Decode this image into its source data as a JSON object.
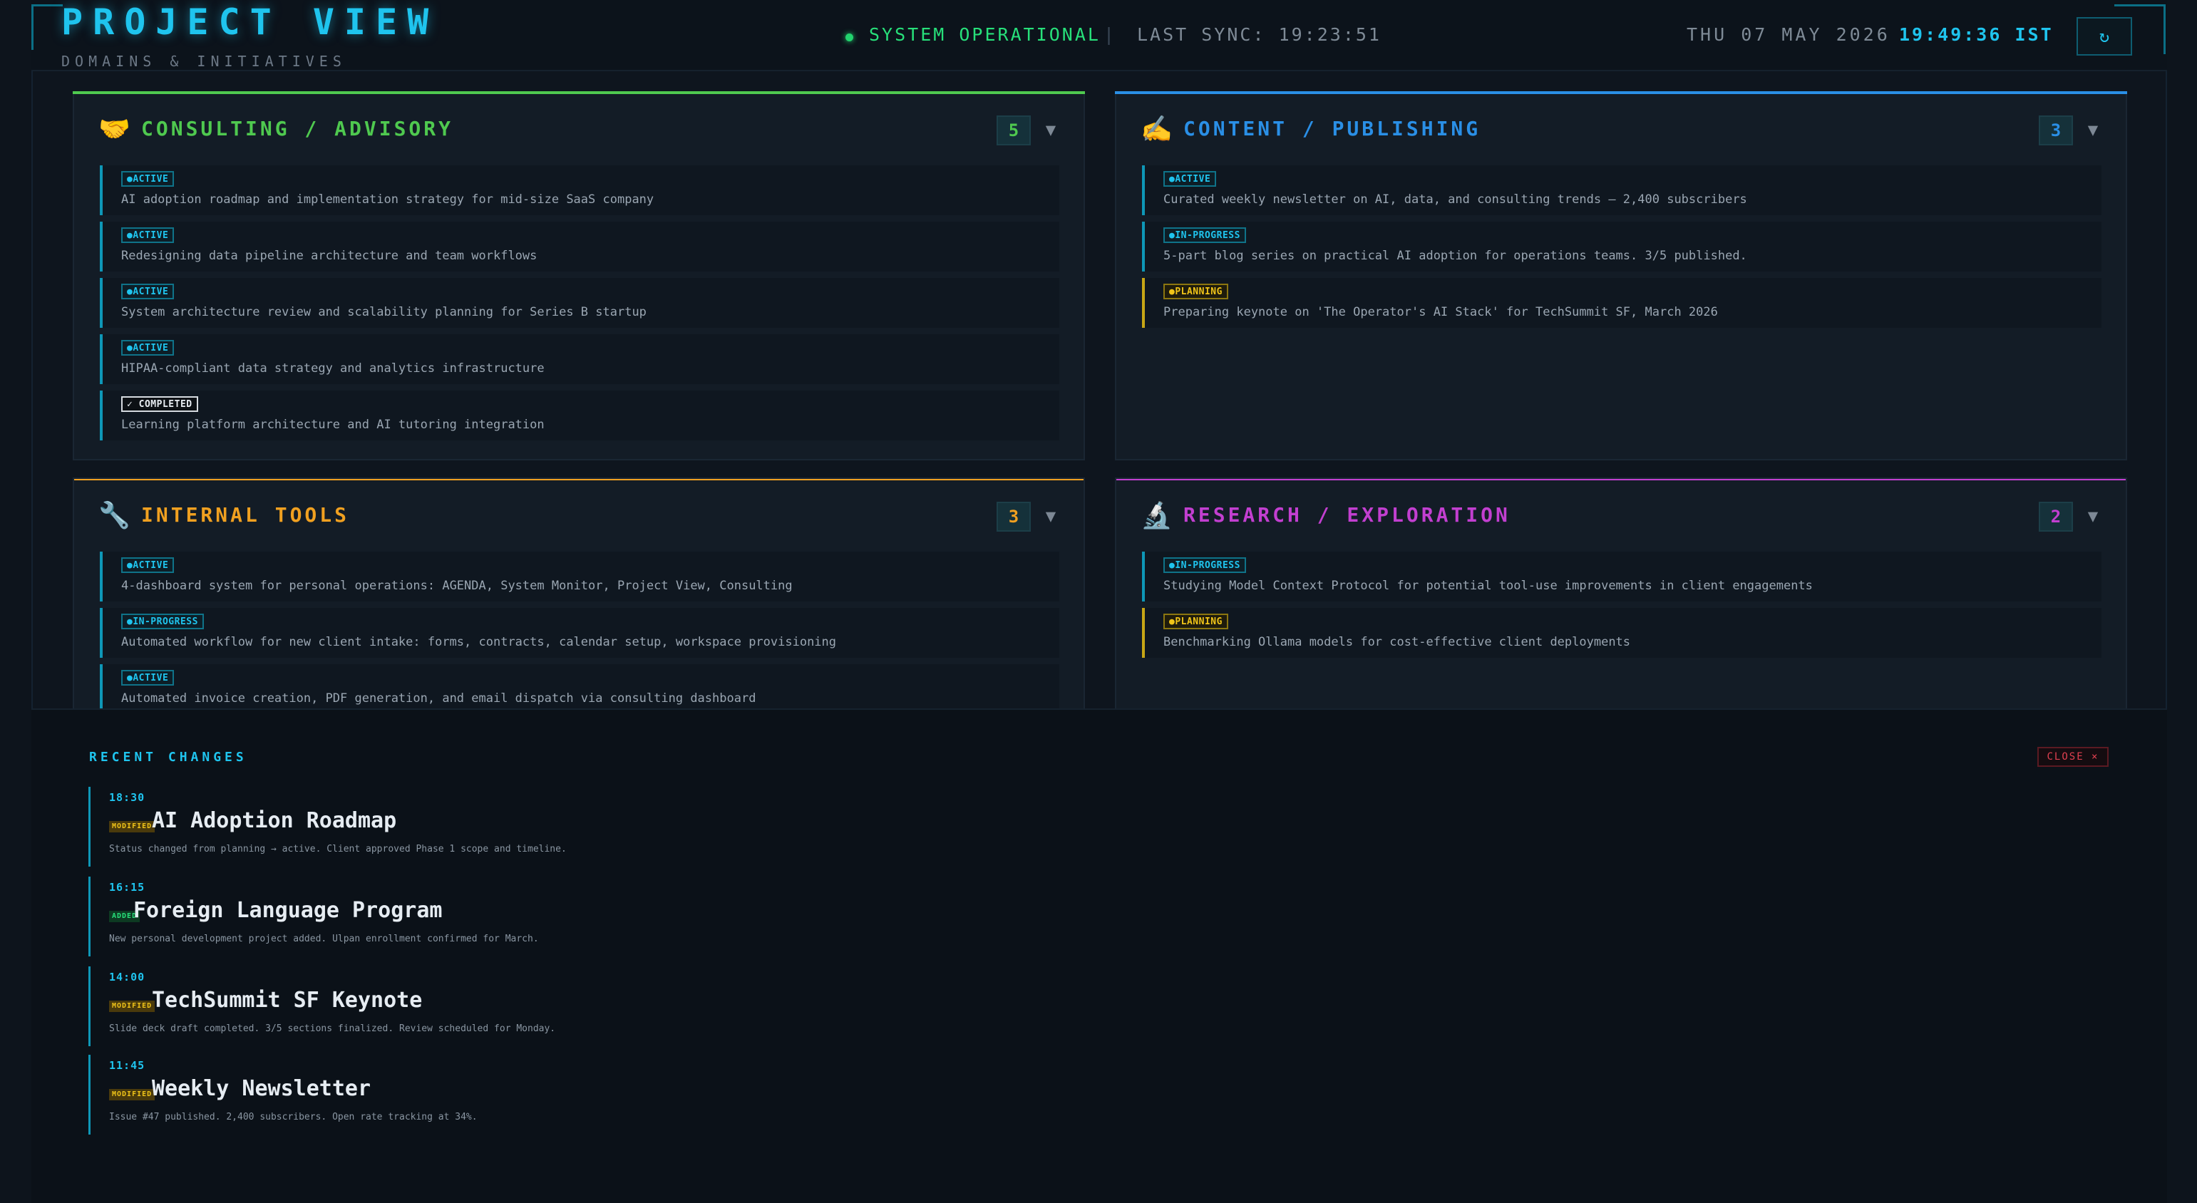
{
  "header": {
    "title": "PROJECT VIEW",
    "subtitle": "DOMAINS & INITIATIVES",
    "status": "SYSTEM OPERATIONAL",
    "separator": "|",
    "last_sync": "LAST SYNC: 19:23:51",
    "date": "THU 07 MAY 2026",
    "time": "19:49:36 IST",
    "refresh_icon": "↻"
  },
  "colors": {
    "accent": "#1fc4ee",
    "consulting": "#4fc94f",
    "content": "#2a8fe6",
    "internal": "#f0a020",
    "research": "#c23fd0",
    "planning": "#f0c419",
    "operational": "#27e07a"
  },
  "panels": [
    {
      "icon": "🤝",
      "icon_name": "handshake-icon",
      "title": "CONSULTING / ADVISORY",
      "count": "5",
      "chevron": "▼",
      "items": [
        {
          "status": "●ACTIVE",
          "kind": "active",
          "text": "AI adoption roadmap and implementation strategy for mid-size SaaS company"
        },
        {
          "status": "●ACTIVE",
          "kind": "active",
          "text": "Redesigning data pipeline architecture and team workflows"
        },
        {
          "status": "●ACTIVE",
          "kind": "active",
          "text": "System architecture review and scalability planning for Series B startup"
        },
        {
          "status": "●ACTIVE",
          "kind": "active",
          "text": "HIPAA-compliant data strategy and analytics infrastructure"
        },
        {
          "status": "✓ COMPLETED",
          "kind": "completed",
          "text": "Learning platform architecture and AI tutoring integration"
        }
      ]
    },
    {
      "icon": "✍️",
      "icon_name": "writing-hand-icon",
      "title": "CONTENT / PUBLISHING",
      "count": "3",
      "chevron": "▼",
      "items": [
        {
          "status": "●ACTIVE",
          "kind": "active",
          "text": "Curated weekly newsletter on AI, data, and consulting trends — 2,400 subscribers"
        },
        {
          "status": "●IN-PROGRESS",
          "kind": "active",
          "text": "5-part blog series on practical AI adoption for operations teams. 3/5 published."
        },
        {
          "status": "●PLANNING",
          "kind": "planning",
          "text": "Preparing keynote on 'The Operator's AI Stack' for TechSummit SF, March 2026"
        }
      ]
    },
    {
      "icon": "🔧",
      "icon_name": "wrench-icon",
      "title": "INTERNAL TOOLS",
      "count": "3",
      "chevron": "▼",
      "items": [
        {
          "status": "●ACTIVE",
          "kind": "active",
          "text": "4-dashboard system for personal operations: AGENDA, System Monitor, Project View, Consulting"
        },
        {
          "status": "●IN-PROGRESS",
          "kind": "active",
          "text": "Automated workflow for new client intake: forms, contracts, calendar setup, workspace provisioning"
        },
        {
          "status": "●ACTIVE",
          "kind": "active",
          "text": "Automated invoice creation, PDF generation, and email dispatch via consulting dashboard"
        }
      ]
    },
    {
      "icon": "🔬",
      "icon_name": "microscope-icon",
      "title": "RESEARCH / EXPLORATION",
      "count": "2",
      "chevron": "▼",
      "items": [
        {
          "status": "●IN-PROGRESS",
          "kind": "active",
          "text": "Studying Model Context Protocol for potential tool-use improvements in client engagements"
        },
        {
          "status": "●PLANNING",
          "kind": "planning",
          "text": "Benchmarking Ollama models for cost-effective client deployments"
        }
      ]
    }
  ],
  "recent": {
    "title": "RECENT CHANGES",
    "close_label": "CLOSE ×",
    "changes": [
      {
        "time": "18:30",
        "tag": "MODIFIED",
        "kind": "modified",
        "name": "AI Adoption Roadmap",
        "desc": "Status changed from planning → active. Client approved Phase 1 scope and timeline."
      },
      {
        "time": "16:15",
        "tag": "ADDED",
        "kind": "added",
        "name": "Foreign Language Program",
        "desc": "New personal development project added. Ulpan enrollment confirmed for March."
      },
      {
        "time": "14:00",
        "tag": "MODIFIED",
        "kind": "modified",
        "name": "TechSummit SF Keynote",
        "desc": "Slide deck draft completed. 3/5 sections finalized. Review scheduled for Monday."
      },
      {
        "time": "11:45",
        "tag": "MODIFIED",
        "kind": "modified",
        "name": "Weekly Newsletter",
        "desc": "Issue #47 published. 2,400 subscribers. Open rate tracking at 34%."
      }
    ]
  }
}
